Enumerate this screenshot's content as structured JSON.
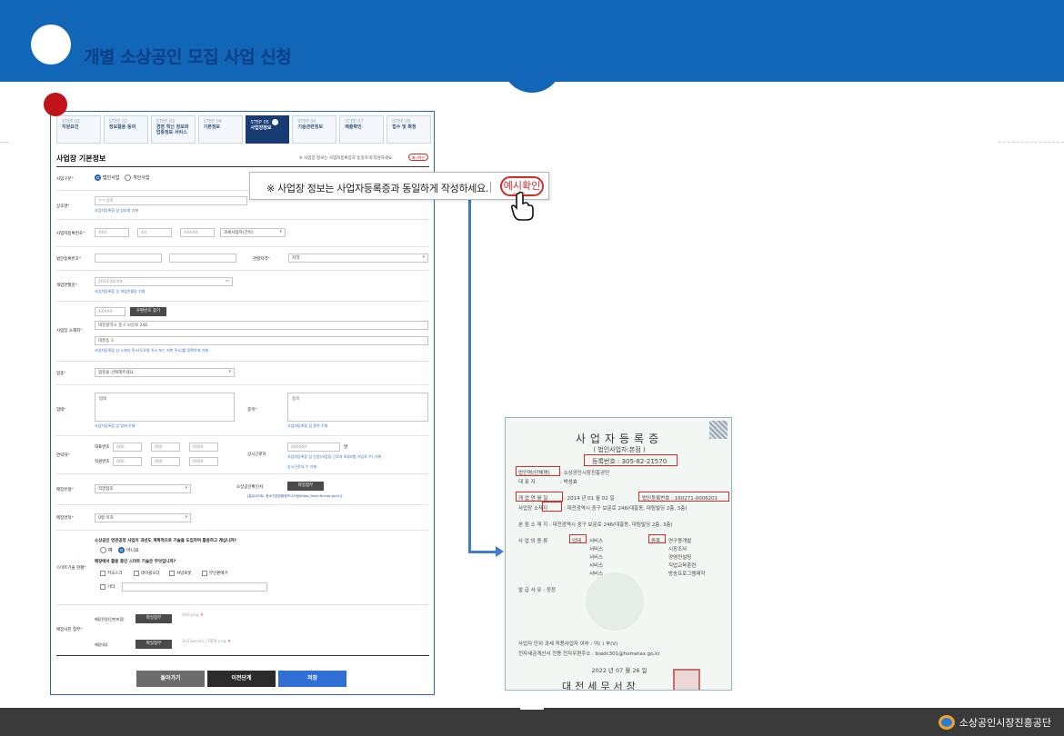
{
  "header": {
    "title": "개별 소상공인 모집 사업 신청"
  },
  "steps": [
    {
      "num": "STEP 01",
      "label": "지원요건"
    },
    {
      "num": "STEP 02",
      "label": "정보활용 동의"
    },
    {
      "num": "STEP 03",
      "label": "경영 혁신 정보화 업종정보 서비스"
    },
    {
      "num": "STEP 04",
      "label": "기본정보"
    },
    {
      "num": "STEP 05",
      "label": "사업장정보"
    },
    {
      "num": "STEP 06",
      "label": "기술관련정보"
    },
    {
      "num": "STEP 07",
      "label": "제출확인"
    },
    {
      "num": "STEP 08",
      "label": "접수 및 확정"
    }
  ],
  "form": {
    "section_title": "사업장 기본정보",
    "section_note": "※ 사업장 정보는 사업자등록증과 동일하게 작성하세요.",
    "section_note_btn": "예시확인",
    "biz_type": {
      "label": "사업구분",
      "opt1": "법인사업",
      "opt2": "개인사업"
    },
    "company_name": {
      "label": "상호명",
      "placeholder": "ㅇㅇ상회",
      "hint": "사업자등록증 상 상호명 기재"
    },
    "biz_no": {
      "label": "사업자등록번호",
      "p1": "XXX",
      "p2": "XX",
      "p3": "XXXXX",
      "status": "과세사업자(간이)"
    },
    "corp_no": {
      "label": "법인등록번호"
    },
    "region": {
      "label": "관할지역",
      "value": "지역"
    },
    "open_date": {
      "label": "개업연월일",
      "placeholder": "2024-XX-XX",
      "hint": "사업자등록증 상 개업연월일 기재"
    },
    "address": {
      "label": "사업장 소재지",
      "zip": "XXXXX",
      "zip_btn": "우편번호 찾기",
      "addr1": "대전광역시 중구 보문로 246",
      "addr2": "대흥동 3",
      "hint": "사업자등록증 상 소재지 주소(도로명 주소 또는 지번 주소)를 정확하게 기재"
    },
    "industry": {
      "label": "업종",
      "value": "업종을 선택해주세요."
    },
    "business": {
      "label": "업태",
      "value": "업태",
      "hint": "사업자등록증 상 업태 기재"
    },
    "item": {
      "label": "종목",
      "value": "종목",
      "hint": "사업자등록증 상 종목 기재"
    },
    "contact": {
      "label": "연락처",
      "tel_label": "대표번호",
      "mobile_label": "직원번호",
      "t1": "000",
      "t2": "000",
      "t3": "0000",
      "emp_label": "상시근로자",
      "emp_placeholder": "000000",
      "emp_unit": "명",
      "emp_hint": "사업자등록증 상 인원(사업장 근로자 4대보험 가입자 수) 기재",
      "emp_hint2": "상시근로자 수 기재"
    },
    "store_type": {
      "label": "매장유형",
      "value": "직영점포"
    },
    "cert": {
      "label": "소상공인확인서",
      "btn": "파일첨부",
      "hint": "[발급사이트: 중소기업현황정보시스템(https://sminfo.mss.go.kr)]"
    },
    "store_area": {
      "label": "매장면적",
      "value": "0평 이하"
    },
    "smart": {
      "label": "스마트기술 현황",
      "q1": "소상공인 연관공정 사업의 과년도 계획적으로 기술을 도입하여 활용하고 계십니까?",
      "yes": "예",
      "no": "아니요",
      "q2": "매장에서 활용 중인 스마트 기술은 무엇입니까?",
      "opt1": "키오스크",
      "opt2": "테이블오더",
      "opt3": "서빙로봇",
      "opt4": "무인판매기",
      "opt5": "기타"
    },
    "photos": {
      "label": "매장사진 첨부",
      "row1_label": "매장전경(간판포함)",
      "row1_btn": "파일첨부",
      "row1_file": "000.png",
      "row2_label": "매장내부",
      "row2_btn": "파일첨부",
      "row2_file": "2023email_기재해.png"
    },
    "buttons": {
      "back": "돌아가기",
      "prev": "이전단계",
      "save": "저장"
    }
  },
  "callout": {
    "text": "※ 사업장 정보는 사업자등록증과 동일하게 작성하세요.",
    "btn": "예시확인"
  },
  "certificate": {
    "title": "사업자등록증",
    "subtitle": "( 법인사업자:본점 )",
    "reg_no": "등록번호 : 305-82-21570",
    "corp_name_label": "법인명(단체명)",
    "corp_name": ": 소상공인시장진흥공단",
    "rep_label": "대 표 자",
    "rep": ": 박성효",
    "open_label": "개 업 연 월 일",
    "open": ": 2014 년 01 월 02 일",
    "corp_reg": "법인등록번호 : 160271-0006201",
    "loc_label": "사업장 소재지",
    "loc": ": 대전광역시 중구 보문로 246(대흥동, 대림빌딩 2층, 3층)",
    "hq": "본 점 소 재 지 : 대전광역시 중구 보문로 246(대흥동, 대림빌딩 2층, 3층)",
    "type_label": "사 업 의 종 류",
    "type1": "업태",
    "type2": "종목",
    "biz_items": [
      "서비스",
      "서비스",
      "서비스",
      "서비스",
      "서비스"
    ],
    "item_items": [
      "연구용개발",
      "시장조사",
      "경영컨설팅",
      "직업교육훈련",
      "방송프로그램제작"
    ],
    "issue": "발 급 사 유 : 정정",
    "tax_unit": "사업자 단위 과세 적용사업자 여부 : 여( ) 부(V)",
    "email": "전자세금계산서 전용 전자우편주소 : biadc301@hometax.go.kr",
    "date": "2022 년 07 월 26 일",
    "office": "대전세무서장"
  },
  "footer": {
    "org": "소상공인시장진흥공단"
  }
}
